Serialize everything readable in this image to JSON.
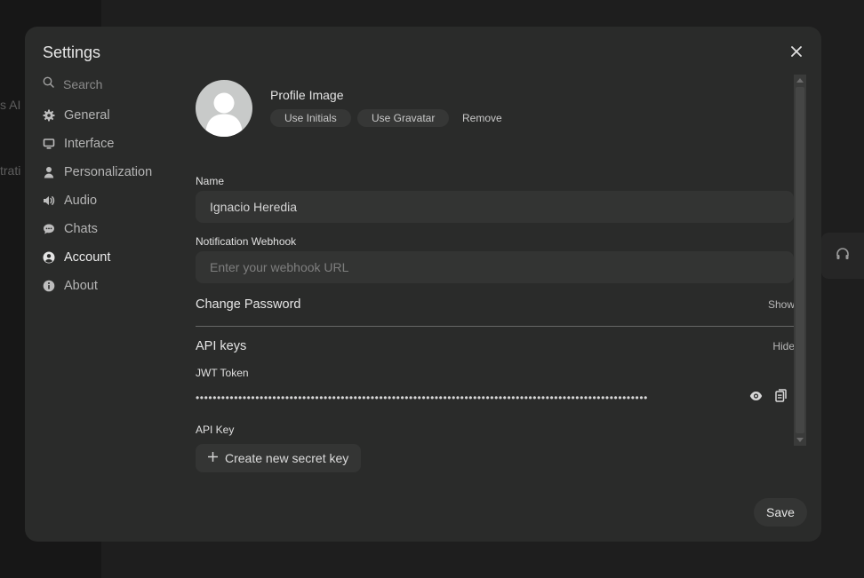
{
  "background": {
    "snippet_1": "s AI S",
    "snippet_2": "trati"
  },
  "modal": {
    "title": "Settings"
  },
  "sidebar": {
    "search_placeholder": "Search",
    "items": [
      {
        "label": "General",
        "icon": "gear-icon"
      },
      {
        "label": "Interface",
        "icon": "monitor-icon"
      },
      {
        "label": "Personalization",
        "icon": "person-icon"
      },
      {
        "label": "Audio",
        "icon": "speaker-icon"
      },
      {
        "label": "Chats",
        "icon": "chat-bubble-icon"
      },
      {
        "label": "Account",
        "icon": "user-circle-icon",
        "active": true
      },
      {
        "label": "About",
        "icon": "info-icon"
      }
    ]
  },
  "account": {
    "profile_image_label": "Profile Image",
    "use_initials": "Use Initials",
    "use_gravatar": "Use Gravatar",
    "remove": "Remove",
    "name_label": "Name",
    "name_value": "Ignacio Heredia",
    "webhook_label": "Notification Webhook",
    "webhook_placeholder": "Enter your webhook URL",
    "change_password": "Change Password",
    "show": "Show",
    "api_keys": "API keys",
    "hide": "Hide",
    "jwt_label": "JWT Token",
    "jwt_masked": "••••••••••••••••••••••••••••••••••••••••••••••••••••••••••••••••••••••••••••••••••••••••••••••••••••••••••",
    "api_key_label": "API Key",
    "create_key": "Create new secret key"
  },
  "footer": {
    "save": "Save"
  },
  "colors": {
    "modal_bg": "#2a2b2a",
    "input_bg": "#333433",
    "text": "#e5e5e5"
  }
}
